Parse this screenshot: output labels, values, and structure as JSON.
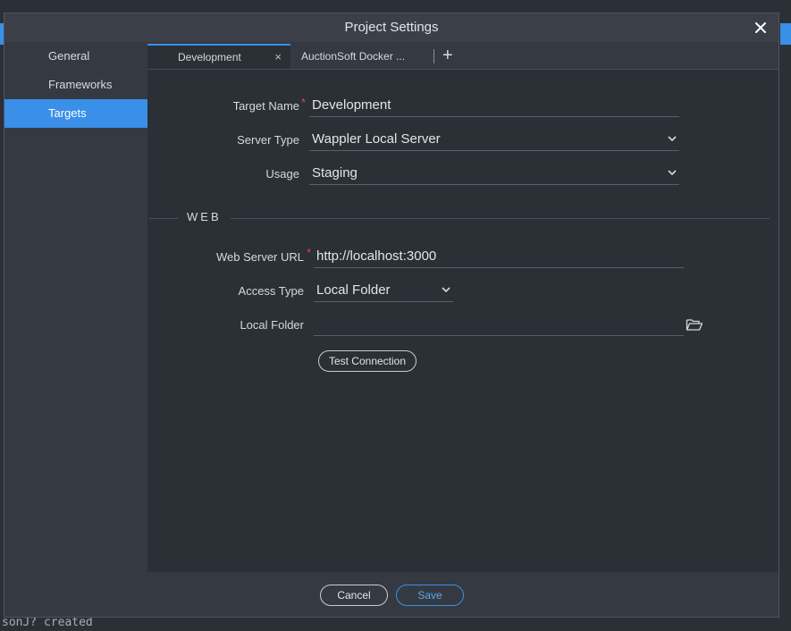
{
  "dialog": {
    "title": "Project Settings"
  },
  "sidebar": {
    "items": [
      {
        "label": "General"
      },
      {
        "label": "Frameworks"
      },
      {
        "label": "Targets"
      }
    ]
  },
  "tabs": {
    "items": [
      {
        "label": "Development"
      },
      {
        "label": "AuctionSoft Docker ..."
      }
    ],
    "close_glyph": "×",
    "add_glyph": "+"
  },
  "form": {
    "target_name": {
      "label": "Target Name",
      "value": "Development"
    },
    "server_type": {
      "label": "Server Type",
      "value": "Wappler Local Server"
    },
    "usage": {
      "label": "Usage",
      "value": "Staging"
    },
    "web_section": {
      "title": "WEB"
    },
    "web_server_url": {
      "label": "Web Server URL",
      "value": "http://localhost:3000"
    },
    "access_type": {
      "label": "Access Type",
      "value": "Local Folder"
    },
    "local_folder": {
      "label": "Local Folder",
      "value": ""
    },
    "required_mark": "*",
    "test_connection_label": "Test Connection"
  },
  "footer": {
    "cancel_label": "Cancel",
    "save_label": "Save"
  },
  "background": {
    "terminal_text": "sonJ? created"
  },
  "colors": {
    "accent": "#3a8fe8",
    "required": "#e0463e"
  },
  "icons": [
    "close-icon",
    "plus-icon",
    "chevron-down-icon",
    "folder-open-icon"
  ]
}
